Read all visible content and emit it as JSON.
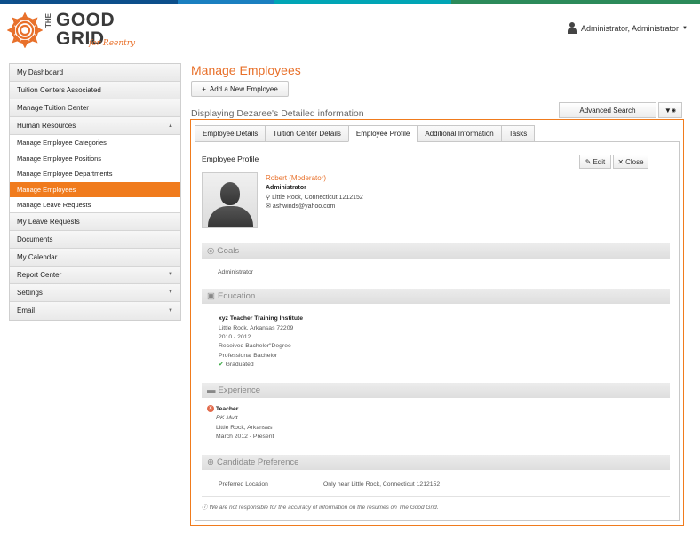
{
  "topbar_colors": [
    "#0d4f8b",
    "#1a7fc0",
    "#00a5b5",
    "#2c8a5a"
  ],
  "logo": {
    "the": "THE",
    "good": "GOOD",
    "grid": "GRID",
    "reentry": "for Reentry",
    "accent": "#e8702a"
  },
  "user": {
    "name": "Administrator, Administrator",
    "dropdown_icon": "caret-down-icon"
  },
  "sidebar": {
    "items": [
      {
        "label": "My Dashboard"
      },
      {
        "label": "Tuition Centers Associated"
      },
      {
        "label": "Manage Tuition Center"
      },
      {
        "label": "Human Resources",
        "caret": "▲"
      }
    ],
    "subitems": [
      {
        "label": "Manage Employee Categories"
      },
      {
        "label": "Manage Employee Positions"
      },
      {
        "label": "Manage Employee Departments"
      },
      {
        "label": "Manage Employees",
        "active": true
      },
      {
        "label": "Manage Leave Requests"
      }
    ],
    "items_after": [
      {
        "label": "My Leave Requests"
      },
      {
        "label": "Documents"
      },
      {
        "label": "My Calendar"
      },
      {
        "label": "Report Center",
        "caret": "▼"
      },
      {
        "label": "Settings",
        "caret": "▼"
      },
      {
        "label": "Email",
        "caret": "▼"
      }
    ]
  },
  "main": {
    "title": "Manage Employees",
    "add_button": "Add a New Employee",
    "display_line": "Displaying Dezaree's Detailed information",
    "advanced_search": "Advanced Search"
  },
  "tabs": [
    {
      "label": "Employee Details"
    },
    {
      "label": "Tuition Center Details"
    },
    {
      "label": "Employee Profile",
      "active": true
    },
    {
      "label": "Additional Information"
    },
    {
      "label": "Tasks"
    }
  ],
  "profile": {
    "title": "Employee Profile",
    "edit": "Edit",
    "close": "Close",
    "name": "Robert (Moderator)",
    "role": "Administrator",
    "location": "Little Rock, Connecticut 1212152",
    "email": "ashwinds@yahoo.com"
  },
  "goals": {
    "header": "Goals",
    "text": "Administrator"
  },
  "education": {
    "header": "Education",
    "institution": "xyz Teacher Training Institute",
    "location": "Little Rock, Arkansas 72209",
    "years": "2010 - 2012",
    "degree": "Received Bachelor\"Degree",
    "level": "Professional Bachelor",
    "status": "Graduated"
  },
  "experience": {
    "header": "Experience",
    "role": "Teacher",
    "company": "RK Mutt",
    "location": "Little Rock, Arkansas",
    "dates": "March 2012 - Present"
  },
  "preference": {
    "header": "Candidate Preference",
    "label": "Preferred Location",
    "value": "Only near Little Rock, Connecticut 1212152"
  },
  "footer_note": "We are not responsible for the accuracy of information on the resumes on The Good Grid."
}
